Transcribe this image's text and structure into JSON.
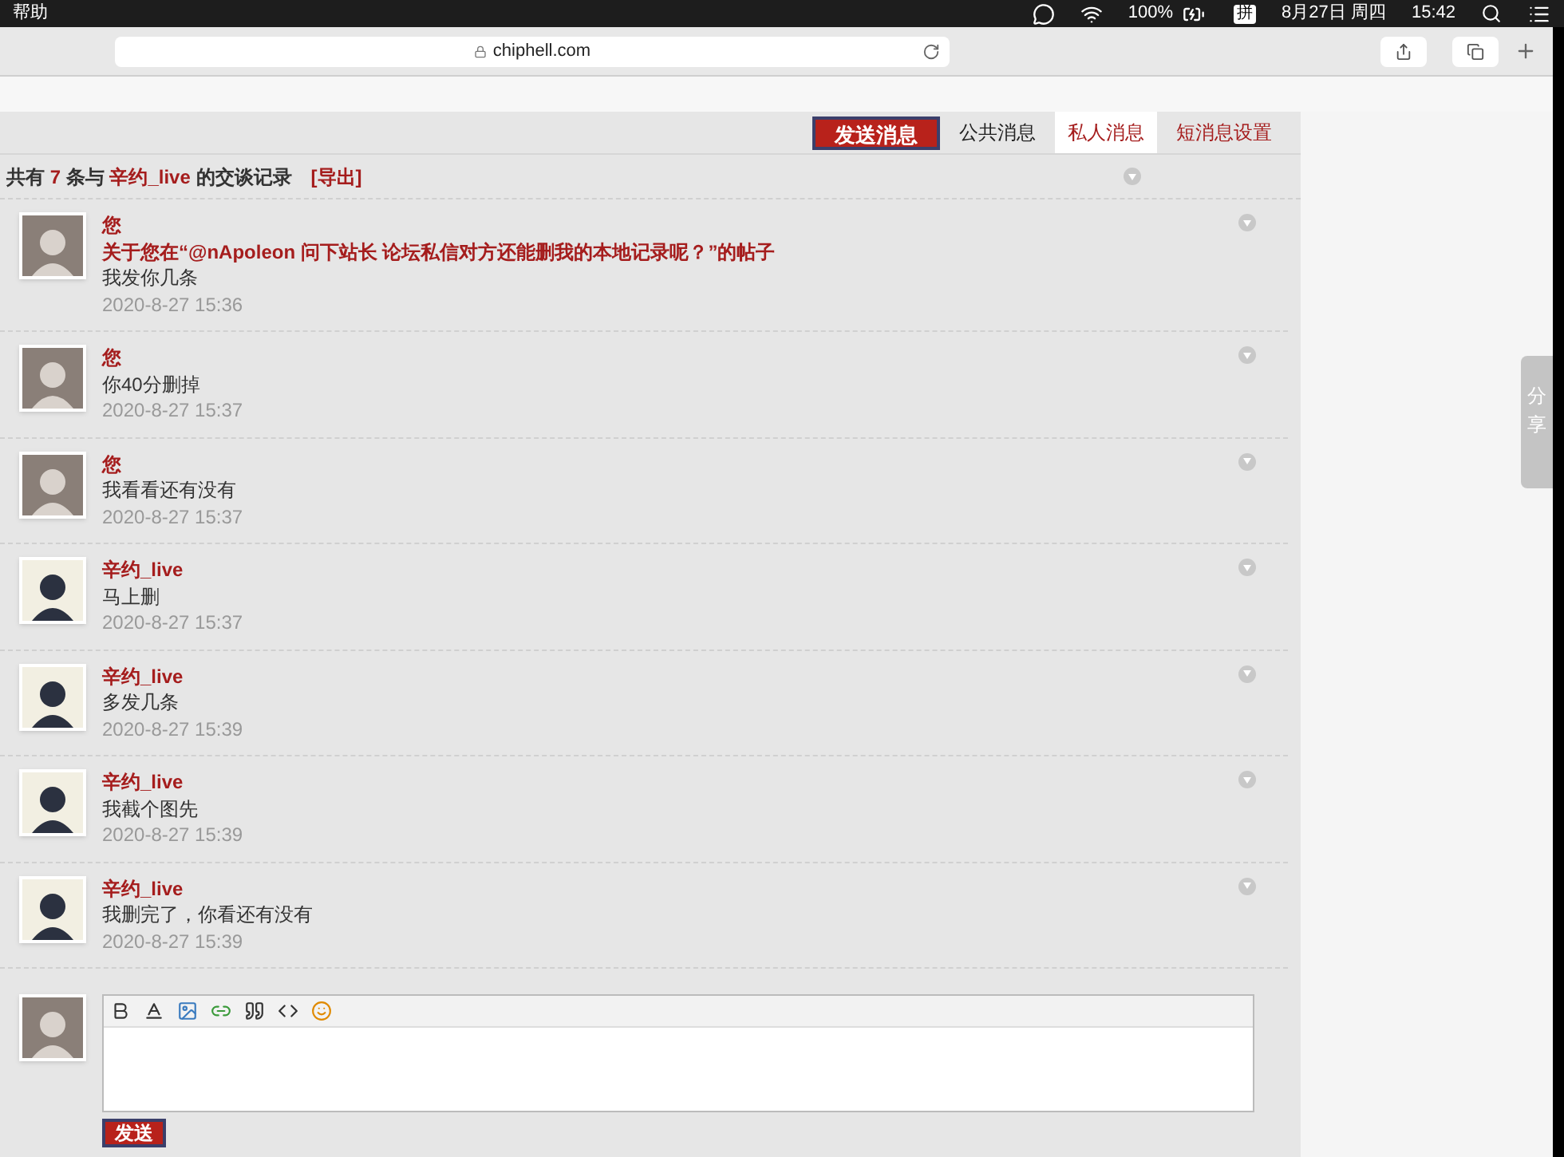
{
  "menu_bar": {
    "menu": "帮助",
    "battery": "100%",
    "input_method": "拼",
    "date": "8月27日 周四",
    "time": "15:42"
  },
  "browser": {
    "url": "chiphell.com"
  },
  "tabs": [
    {
      "label": "发送消息",
      "kind": "button",
      "selected": false
    },
    {
      "label": "公共消息",
      "kind": "tab",
      "selected": false
    },
    {
      "label": "私人消息",
      "kind": "tab",
      "selected": true
    },
    {
      "label": "短消息设置",
      "kind": "link",
      "selected": false
    }
  ],
  "summary": {
    "before": "共有",
    "count": "7",
    "middle": "条与",
    "user": "辛约_live",
    "after": "的交谈记录",
    "export_link": "[导出]"
  },
  "messages": [
    {
      "sender": "您",
      "kind": "self",
      "subject": "关于您在“@nApoleon 问下站长 论坛私信对方还能删我的本地记录呢？”的帖子",
      "body": "我发你几条",
      "time": "2020-8-27 15:36"
    },
    {
      "sender": "您",
      "kind": "self",
      "body": "你40分删掉",
      "time": "2020-8-27 15:37"
    },
    {
      "sender": "您",
      "kind": "self",
      "body": "我看看还有没有",
      "time": "2020-8-27 15:37"
    },
    {
      "sender": "辛约_live",
      "kind": "other",
      "body": "马上删",
      "time": "2020-8-27 15:37"
    },
    {
      "sender": "辛约_live",
      "kind": "other",
      "body": "多发几条",
      "time": "2020-8-27 15:39"
    },
    {
      "sender": "辛约_live",
      "kind": "other",
      "body": "我截个图先",
      "time": "2020-8-27 15:39"
    },
    {
      "sender": "辛约_live",
      "kind": "other",
      "body": "我删完了，你看还有没有",
      "time": "2020-8-27 15:39"
    }
  ],
  "reply": {
    "send_button": "发送"
  },
  "share_tab": "分享"
}
